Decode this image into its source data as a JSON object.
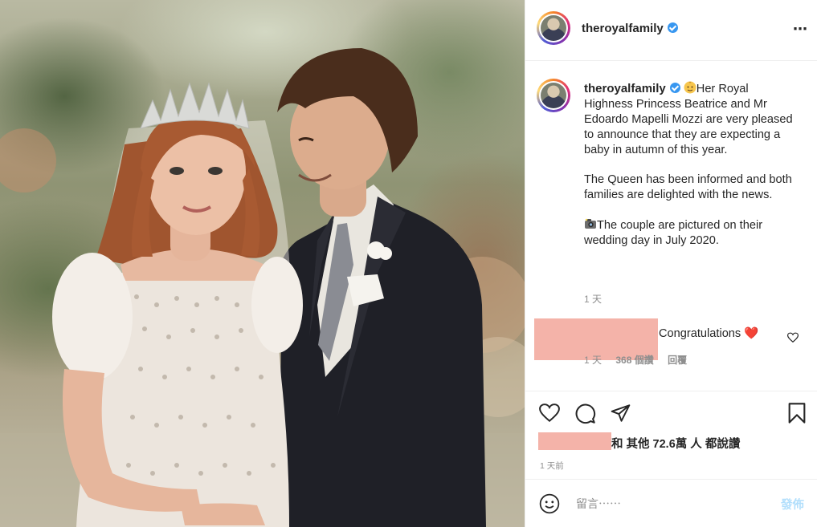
{
  "header": {
    "username": "theroyalfamily",
    "more_icon": "⋯"
  },
  "caption": {
    "username": "theroyalfamily",
    "emoji_1": "baby-emoji",
    "paragraph_1": "Her Royal Highness Princess Beatrice and Mr Edoardo Mapelli Mozzi are very pleased to announce that they are expecting a baby in autumn of this year.",
    "paragraph_2": "The Queen has been informed and both families are delighted with the news.",
    "emoji_2": "camera-emoji",
    "paragraph_3": "The couple are pictured on their wedding day in July 2020.",
    "time": "1 天"
  },
  "comment": {
    "text": "Congratulations",
    "emoji": "❤️",
    "time": "1 天",
    "likes": "368 個讚",
    "reply": "回覆"
  },
  "actions": {
    "likes_suffix": "和 其他 72.6萬 人 都說讚",
    "post_time": "1 天前"
  },
  "comment_bar": {
    "placeholder": "留言⋯⋯",
    "post_label": "發佈"
  },
  "colors": {
    "verified": "#3897f0",
    "redaction": "#f4b3a9",
    "post_button_disabled": "#b2dffc",
    "heart_red": "#ed4956"
  }
}
